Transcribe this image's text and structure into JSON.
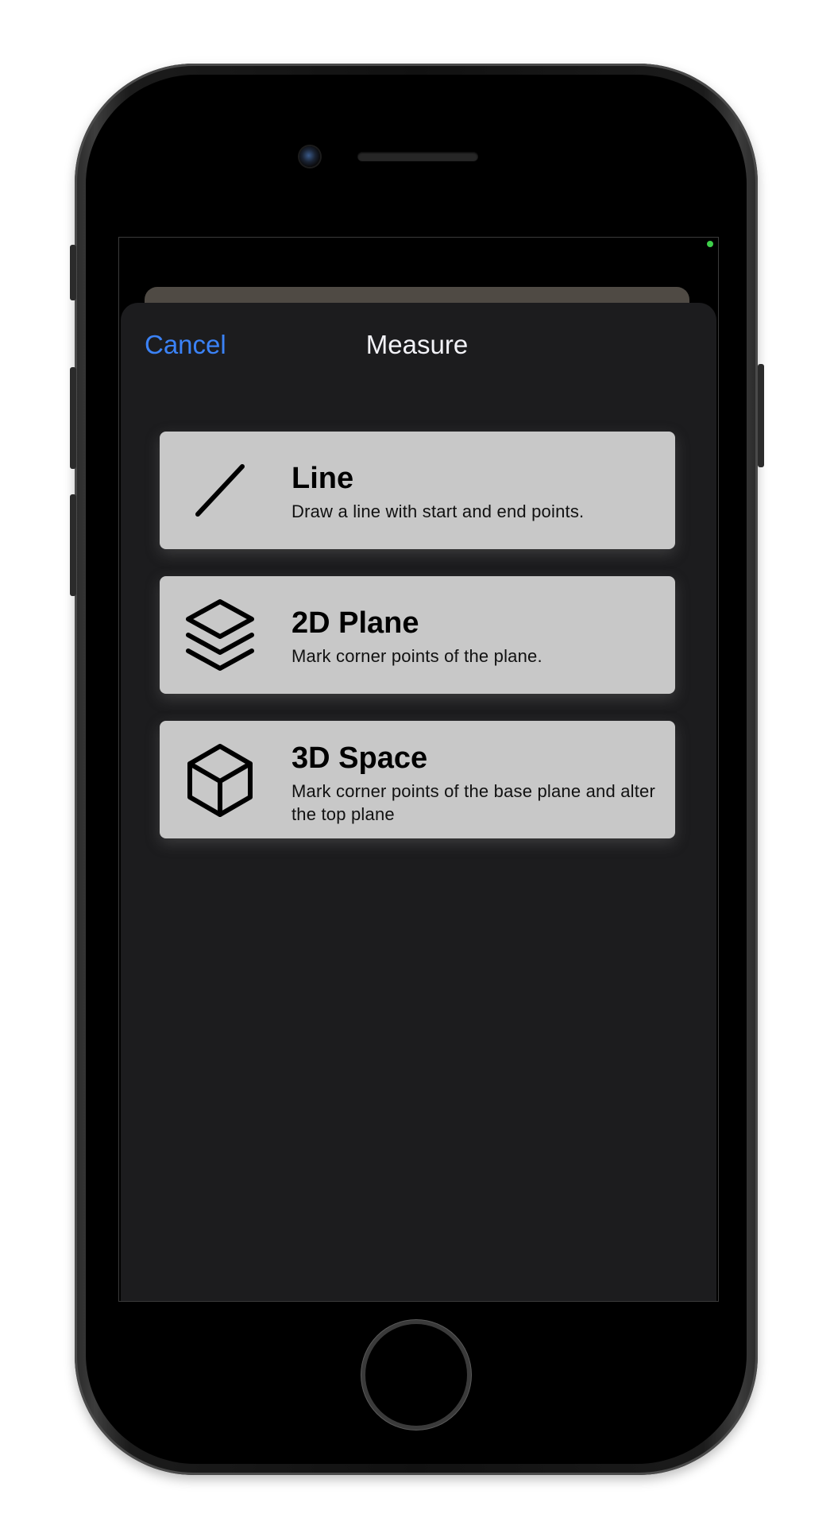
{
  "sheet": {
    "nav": {
      "cancel_label": "Cancel",
      "title": "Measure"
    },
    "options": [
      {
        "title": "Line",
        "description": "Draw a line with start and end points.",
        "icon": "line-icon"
      },
      {
        "title": "2D Plane",
        "description": "Mark corner points of the plane.",
        "icon": "layers-icon"
      },
      {
        "title": "3D Space",
        "description": "Mark corner points of the base plane and alter the top plane",
        "icon": "cube-icon"
      }
    ]
  },
  "colors": {
    "accent": "#3b82f6",
    "sheet_background": "#1c1c1e",
    "card_background": "#c8c8c8",
    "status_indicator": "#3ecf4a"
  }
}
